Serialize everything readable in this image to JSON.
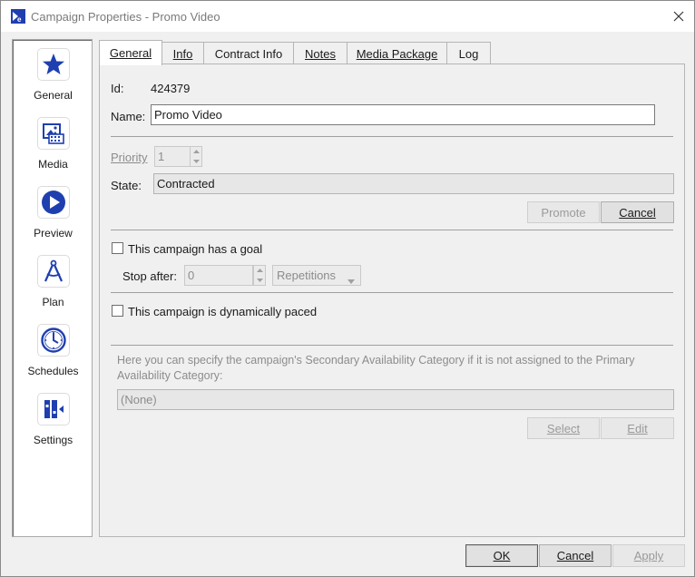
{
  "window": {
    "title": "Campaign Properties - Promo Video"
  },
  "nav": {
    "items": [
      {
        "label": "General",
        "icon": "star-icon"
      },
      {
        "label": "Media",
        "icon": "media-icon"
      },
      {
        "label": "Preview",
        "icon": "play-icon"
      },
      {
        "label": "Plan",
        "icon": "compass-icon"
      },
      {
        "label": "Schedules",
        "icon": "clock-icon"
      },
      {
        "label": "Settings",
        "icon": "settings-icon"
      }
    ]
  },
  "tabs": [
    {
      "label": "General",
      "active": true
    },
    {
      "label": "Info"
    },
    {
      "label": "Contract Info"
    },
    {
      "label": "Notes"
    },
    {
      "label": "Media Package"
    },
    {
      "label": "Log"
    }
  ],
  "general": {
    "id_label": "Id:",
    "id_value": "424379",
    "name_label": "Name:",
    "name_value": "Promo Video",
    "priority_label": "Priority",
    "priority_value": "1",
    "state_label": "State:",
    "state_value": "Contracted",
    "promote_label": "Promote",
    "cancel_state_label": "Cancel",
    "goal_checkbox_label": "This campaign has a goal",
    "goal_checked": false,
    "stop_after_label": "Stop after:",
    "stop_after_value": "0",
    "repetitions_label": "Repetitions",
    "dynamic_checkbox_label": "This campaign is dynamically paced",
    "dynamic_checked": false,
    "secondary_help": "Here you can specify the campaign's Secondary Availability Category if it is not assigned to the Primary Availability Category:",
    "secondary_value": "(None)",
    "select_label": "Select",
    "edit_label": "Edit"
  },
  "footer": {
    "ok_label": "OK",
    "cancel_label": "Cancel",
    "apply_label": "Apply"
  },
  "colors": {
    "accent": "#1f3fb0",
    "nav_icon_border": "#dcdcdc"
  }
}
